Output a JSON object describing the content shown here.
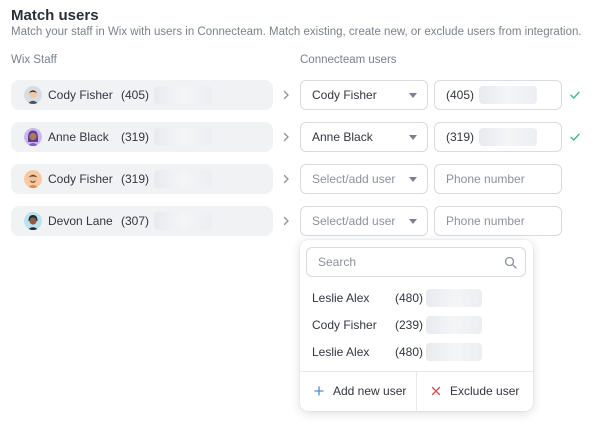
{
  "header": {
    "title": "Match users",
    "subtitle": "Match your staff in Wix with users in Connecteam. Match existing, create new, or exclude users from integration."
  },
  "columns": {
    "wix": "Wix Staff",
    "connecteam": "Connecteam users"
  },
  "rows": [
    {
      "name": "Cody Fisher",
      "phone": "(405)",
      "select": "Cody Fisher",
      "select_placeholder": false,
      "phone_code": "(405)",
      "phone_placeholder": "",
      "matched": true,
      "avatar_color": "#d7dde3"
    },
    {
      "name": "Anne Black",
      "phone": "(319)",
      "select": "Anne Black",
      "select_placeholder": false,
      "phone_code": "(319)",
      "phone_placeholder": "",
      "matched": true,
      "avatar_color": "#c9b6ef"
    },
    {
      "name": "Cody Fisher",
      "phone": "(319)",
      "select": "Select/add user",
      "select_placeholder": true,
      "phone_code": "",
      "phone_placeholder": "Phone number",
      "matched": false,
      "avatar_color": "#f7c9a0"
    },
    {
      "name": "Devon Lane",
      "phone": "(307)",
      "select": "Select/add user",
      "select_placeholder": true,
      "phone_code": "",
      "phone_placeholder": "Phone number",
      "matched": false,
      "avatar_color": "#b9e2ef"
    }
  ],
  "dropdown": {
    "search_placeholder": "Search",
    "options": [
      {
        "name": "Leslie Alex",
        "code": "(480)"
      },
      {
        "name": "Cody Fisher",
        "code": "(239)"
      },
      {
        "name": "Leslie Alex",
        "code": "(480)"
      }
    ],
    "add_label": "Add new user",
    "exclude_label": "Exclude user"
  },
  "colors": {
    "check": "#3fb87f",
    "add_icon": "#4a8be8",
    "exclude_icon": "#e5484d"
  }
}
